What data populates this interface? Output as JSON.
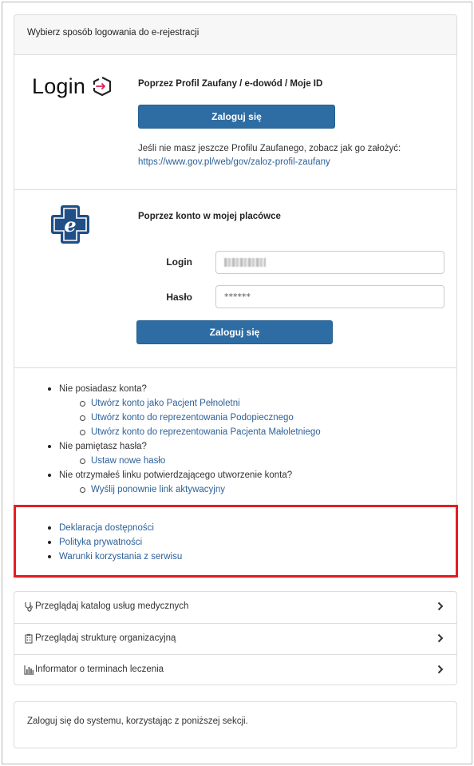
{
  "panel": {
    "heading": "Wybierz sposób logowania do e-rejestracji"
  },
  "profil": {
    "logo_text": "Login",
    "logo_icon": "login-arrow-icon",
    "title": "Poprzez Profil Zaufany / e-dowód / Moje ID",
    "button_label": "Zaloguj się",
    "help_text": "Jeśli nie masz jeszcze Profilu Zaufanego, zobacz jak go założyć:",
    "help_link": "https://www.gov.pl/web/gov/zaloz-profil-zaufany"
  },
  "placowka": {
    "logo_icon": "e-cross-icon",
    "title": "Poprzez konto w mojej placówce",
    "login_label": "Login",
    "login_value": "",
    "password_label": "Hasło",
    "password_value": "******",
    "button_label": "Zaloguj się"
  },
  "account_links": {
    "no_account": "Nie posiadasz konta?",
    "create_adult": "Utwórz konto jako Pacjent Pełnoletni",
    "create_ward": "Utwórz konto do reprezentowania Podopiecznego",
    "create_minor": "Utwórz konto do reprezentowania Pacjenta Małoletniego",
    "forgot_password": "Nie pamiętasz hasła?",
    "set_new_password": "Ustaw nowe hasło",
    "no_activation": "Nie otrzymałeś linku potwierdzającego utworzenie konta?",
    "resend_activation": "Wyślij ponownie link aktywacyjny"
  },
  "footer_links": {
    "accessibility": "Deklaracja dostępności",
    "privacy": "Polityka prywatności",
    "terms": "Warunki korzystania z serwisu"
  },
  "nav_items": [
    {
      "icon": "stethoscope-icon",
      "label": "Przeglądaj katalog usług medycznych"
    },
    {
      "icon": "building-icon",
      "label": "Przeglądaj strukturę organizacyjną"
    },
    {
      "icon": "bar-chart-icon",
      "label": "Informator o terminach leczenia"
    }
  ],
  "info": {
    "text": "Zaloguj się do systemu, korzystając z poniższej sekcji."
  },
  "colors": {
    "primary_button": "#2e6da4",
    "link": "#2d6199",
    "highlight_border": "#e31e24",
    "e_logo": "#1f4f86"
  }
}
